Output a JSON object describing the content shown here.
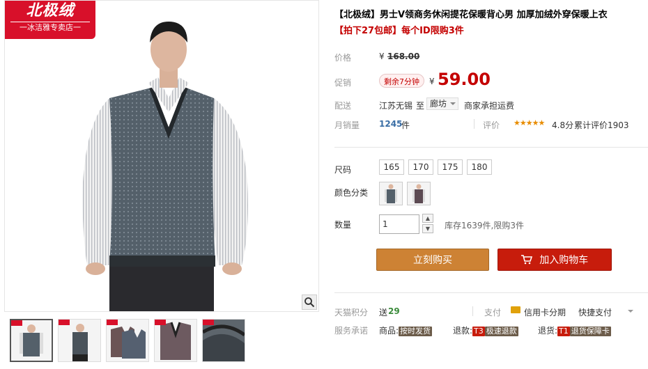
{
  "brand": {
    "logo": "北极绒",
    "store": "一冰洁雅专卖店一"
  },
  "product": {
    "title": "【北极绒】男士V领商务休闲提花保暖背心男 加厚加绒外穿保暖上衣",
    "subtitle": "【拍下27包邮】每个ID限购3件"
  },
  "price": {
    "label": "价格",
    "currency": "¥",
    "original": "168.00"
  },
  "promo": {
    "label": "促销",
    "countdown": "剩余7分钟",
    "currency": "¥",
    "price": "59.00"
  },
  "delivery": {
    "label": "配送",
    "origin": "江苏无锡",
    "to": "至",
    "city": "廊坊",
    "freight": "商家承担运费"
  },
  "sales": {
    "label": "月销量",
    "count": "1245",
    "unit": "件",
    "rating_label": "评价",
    "stars": "★★★★★",
    "score": "4.8分",
    "reviews": "累计评价1903"
  },
  "sizes": {
    "label": "尺码",
    "options": [
      "165",
      "170",
      "175",
      "180"
    ]
  },
  "colors": {
    "label": "颜色分类"
  },
  "quantity": {
    "label": "数量",
    "value": "1",
    "stock": "库存1639件,限购3件",
    "up": "▲",
    "down": "▼"
  },
  "buttons": {
    "buy": "立刻购买",
    "cart": "加入购物车"
  },
  "points": {
    "label": "天猫积分",
    "prefix": "送",
    "value": "29"
  },
  "payment": {
    "label": "支付",
    "credit": "信用卡分期",
    "quick": "快捷支付"
  },
  "service": {
    "label": "服务承诺",
    "goods_label": "商品:",
    "goods_tag": "按时发货",
    "refund_label": "退款:",
    "refund_code": "T3",
    "refund_tag": "极速退款",
    "return_label": "退货:",
    "return_code": "T1",
    "return_tag": "退货保障卡"
  },
  "colors_theme": {
    "accent": "#c40000",
    "buy": "#cd8234",
    "cart": "#c71c0c",
    "logo": "#d8102a"
  }
}
